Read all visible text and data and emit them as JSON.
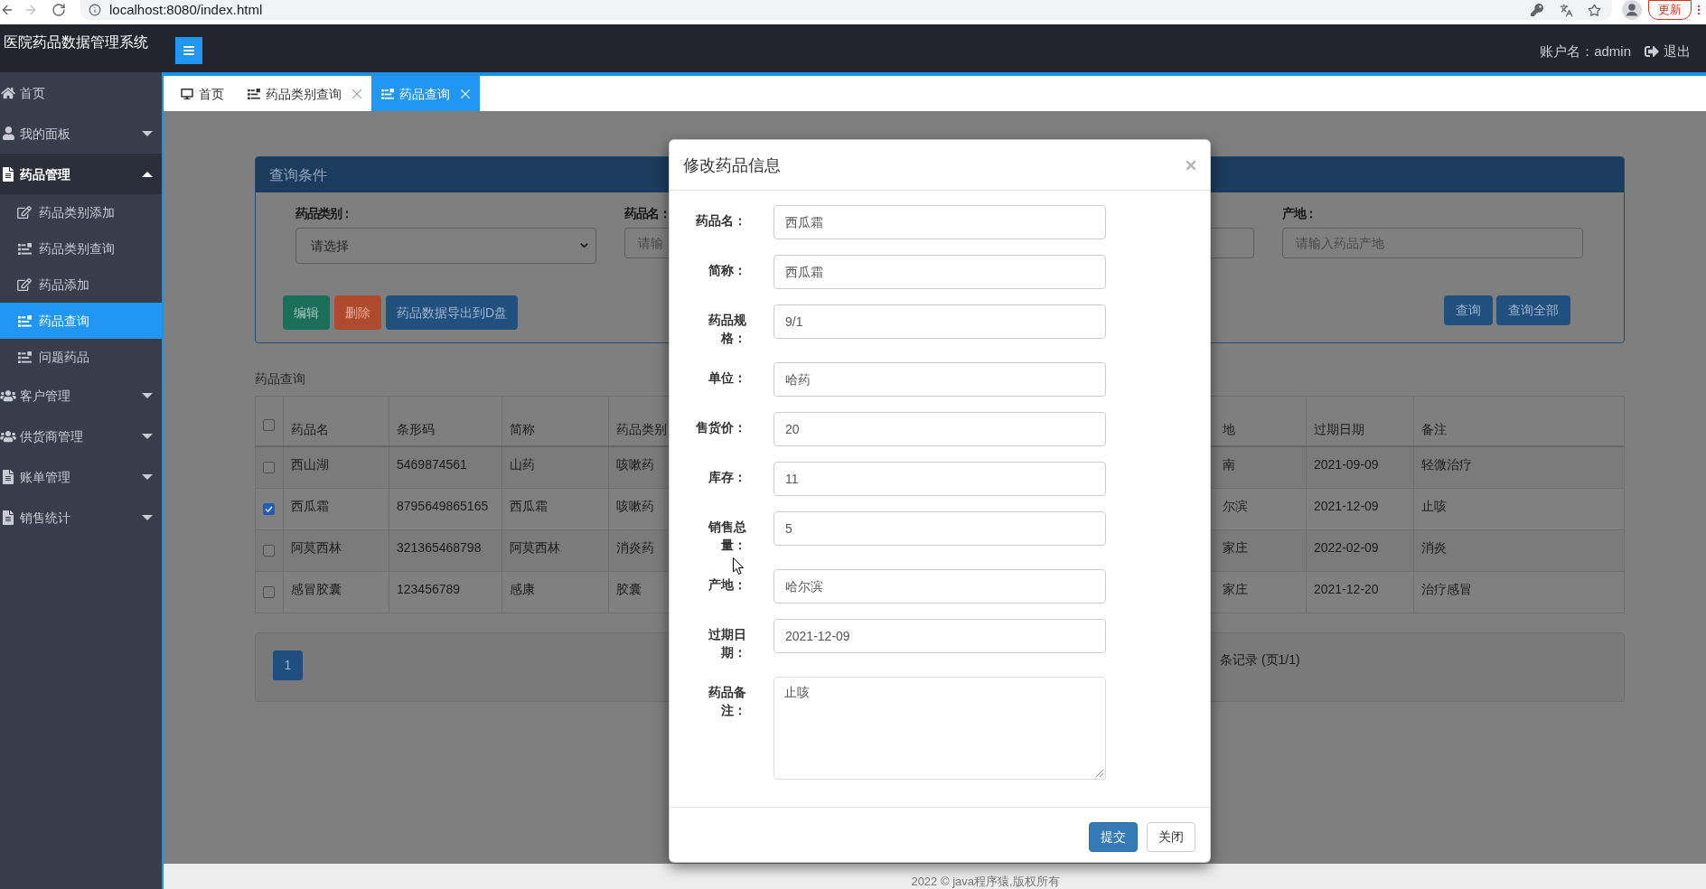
{
  "browser": {
    "url": "localhost:8080/index.html",
    "update_label": "更新"
  },
  "header": {
    "title": "医院药品数据管理系统",
    "account": "账户名：admin",
    "logout": "退出"
  },
  "sidebar": {
    "items": [
      {
        "label": "首页",
        "kind": "link"
      },
      {
        "label": "我的面板",
        "kind": "group",
        "expanded": false
      },
      {
        "label": "药品管理",
        "kind": "group",
        "expanded": true,
        "children": [
          {
            "label": "药品类别添加",
            "selected": false
          },
          {
            "label": "药品类别查询",
            "selected": false
          },
          {
            "label": "药品添加",
            "selected": false
          },
          {
            "label": "药品查询",
            "selected": true
          },
          {
            "label": "问题药品",
            "selected": false
          }
        ]
      },
      {
        "label": "客户管理",
        "kind": "group",
        "expanded": false
      },
      {
        "label": "供货商管理",
        "kind": "group",
        "expanded": false
      },
      {
        "label": "账单管理",
        "kind": "group",
        "expanded": false
      },
      {
        "label": "销售统计",
        "kind": "group",
        "expanded": false
      }
    ]
  },
  "tabs": [
    {
      "label": "首页",
      "selected": false,
      "closable": false
    },
    {
      "label": "药品类别查询",
      "selected": false,
      "closable": true
    },
    {
      "label": "药品查询",
      "selected": true,
      "closable": true
    }
  ],
  "query_panel": {
    "title": "查询条件",
    "fields": [
      {
        "label": "药品类别：",
        "kind": "select",
        "value": "请选择"
      },
      {
        "label": "药品名：",
        "kind": "input",
        "placeholder": "请输"
      },
      {
        "kind": "input"
      },
      {
        "label": "产地：",
        "kind": "input",
        "placeholder": "请输入药品产地"
      }
    ],
    "actions": [
      {
        "label": "编辑",
        "kind": "success"
      },
      {
        "label": "删除",
        "kind": "danger"
      },
      {
        "label": "药品数据导出到D盘",
        "kind": "primary"
      }
    ],
    "search_buttons": [
      "查询",
      "查询全部"
    ]
  },
  "table": {
    "caption": "药品查询",
    "select_all": {
      "checked": false
    },
    "columns": [
      "药品名",
      "条形码",
      "简称",
      "药品类别",
      "地",
      "过期日期",
      "备注"
    ],
    "rows": [
      {
        "checked": false,
        "cells": [
          "西山湖",
          "5469874561",
          "山药",
          "咳嗽药",
          "南",
          "2021-09-09",
          "轻微治疗"
        ]
      },
      {
        "checked": true,
        "cells": [
          "西瓜霜",
          "8795649865165",
          "西瓜霜",
          "咳嗽药",
          "尔滨",
          "2021-12-09",
          "止咳"
        ]
      },
      {
        "checked": false,
        "cells": [
          "阿莫西林",
          "321365468798",
          "阿莫西林",
          "消炎药",
          "家庄",
          "2022-02-09",
          "消炎"
        ]
      },
      {
        "checked": false,
        "cells": [
          "感冒胶囊",
          "123456789",
          "感康",
          "胶囊",
          "家庄",
          "2021-12-20",
          "治疗感冒"
        ]
      }
    ]
  },
  "pagination": {
    "pages": [
      {
        "label": "1",
        "selected": true
      }
    ],
    "summary": "条记录 (页1/1)"
  },
  "modal": {
    "title": "修改药品信息",
    "fields": [
      {
        "label": "药品名：",
        "kind": "input",
        "value": "西瓜霜"
      },
      {
        "label": "简称：",
        "kind": "input",
        "value": "西瓜霜"
      },
      {
        "label": "药品规格：",
        "kind": "input",
        "value": "9/1"
      },
      {
        "label": "单位：",
        "kind": "input",
        "value": "哈药"
      },
      {
        "label": "售货价：",
        "kind": "input",
        "value": "20"
      },
      {
        "label": "库存：",
        "kind": "input",
        "value": "11"
      },
      {
        "label": "销售总量：",
        "kind": "input",
        "value": "5"
      },
      {
        "label": "产地：",
        "kind": "input",
        "value": "哈尔滨"
      },
      {
        "label": "过期日期：",
        "kind": "input",
        "value": "2021-12-09"
      },
      {
        "label": "药品备注：",
        "kind": "textarea",
        "value": "止咳"
      }
    ],
    "buttons": [
      {
        "label": "提交",
        "kind": "primary"
      },
      {
        "label": "关闭",
        "kind": "default"
      }
    ]
  },
  "footer": {
    "text": "2022 © java程序猿,版权所有"
  }
}
